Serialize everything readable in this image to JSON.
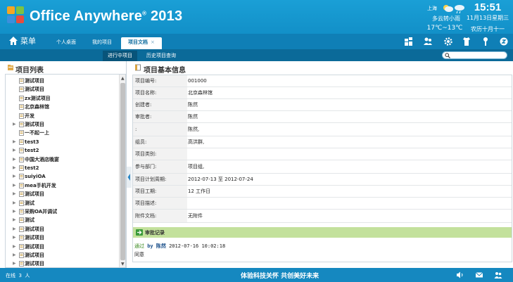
{
  "header": {
    "app_name": "Office Anywhere",
    "app_mark": "®",
    "app_year": "2013",
    "weather": {
      "city": "上海",
      "condition": "多云转小雨",
      "temp": "17℃~13℃"
    },
    "clock": {
      "time": "15:51",
      "date": "11月13日星期三",
      "lunar": "农历十月十一"
    }
  },
  "nav": {
    "menu_label": "菜单",
    "tabs": [
      {
        "label": "个人桌面"
      },
      {
        "label": "我的项目"
      },
      {
        "label": "项目文档",
        "close": "×"
      }
    ],
    "icons": [
      "apps-icon",
      "users-icon",
      "gear-icon",
      "shirt-icon",
      "pin-icon",
      "power-icon"
    ]
  },
  "subnav": {
    "tabs": [
      {
        "label": "进行中项目"
      },
      {
        "label": "历史项目查询"
      }
    ],
    "search_placeholder": ""
  },
  "left": {
    "title": "项目列表",
    "items": [
      {
        "label": "测试项目",
        "expandable": false
      },
      {
        "label": "测试项目",
        "expandable": false
      },
      {
        "label": "zx测试项目",
        "expandable": false
      },
      {
        "label": "北京森林馆",
        "expandable": false
      },
      {
        "label": "开发",
        "expandable": false
      },
      {
        "label": "测试项目",
        "expandable": true
      },
      {
        "label": "一不起一上",
        "expandable": false
      },
      {
        "label": "test3",
        "expandable": true
      },
      {
        "label": "test2",
        "expandable": true
      },
      {
        "label": "中国大酒店晚宴",
        "expandable": true
      },
      {
        "label": "test2",
        "expandable": true
      },
      {
        "label": "suiyiOA",
        "expandable": true
      },
      {
        "label": "mea手机开发",
        "expandable": true
      },
      {
        "label": "测试项目",
        "expandable": true
      },
      {
        "label": "测试",
        "expandable": true
      },
      {
        "label": "采购OA并调试",
        "expandable": true
      },
      {
        "label": "测试",
        "expandable": true
      },
      {
        "label": "测试项目",
        "expandable": true
      },
      {
        "label": "测试项目",
        "expandable": true
      },
      {
        "label": "测试项目",
        "expandable": true
      },
      {
        "label": "测试项目",
        "expandable": true
      },
      {
        "label": "测试项目",
        "expandable": true
      }
    ]
  },
  "right": {
    "title": "项目基本信息",
    "fields": [
      {
        "key": "项目编号:",
        "value": "001000"
      },
      {
        "key": "项目名称:",
        "value": "北京森林馆"
      },
      {
        "key": "创建者:",
        "value": "陈然"
      },
      {
        "key": "审批者:",
        "value": "陈然"
      },
      {
        "key": ":",
        "value": "陈然,"
      },
      {
        "key": "组员:",
        "value": "高洪群,"
      },
      {
        "key": "项目类别:",
        "value": ""
      },
      {
        "key": "参与部门:",
        "value": "项目组,"
      },
      {
        "key": "项目计划周期:",
        "value": "2012-07-13 至 2012-07-24"
      },
      {
        "key": "项目工期:",
        "value": "12 工作日"
      },
      {
        "key": "项目描述:",
        "value": ""
      },
      {
        "key": "附件文档:",
        "value": "无附件"
      }
    ],
    "approval": {
      "title": "审批记录",
      "status": "通过",
      "by": "by 陈然",
      "time": "2012-07-16 10:02:18",
      "comment": "同意"
    }
  },
  "footer": {
    "online_label": "在线",
    "online_count": "3",
    "online_unit": "人",
    "slogan": "体验科技关怀 共创美好未来"
  }
}
